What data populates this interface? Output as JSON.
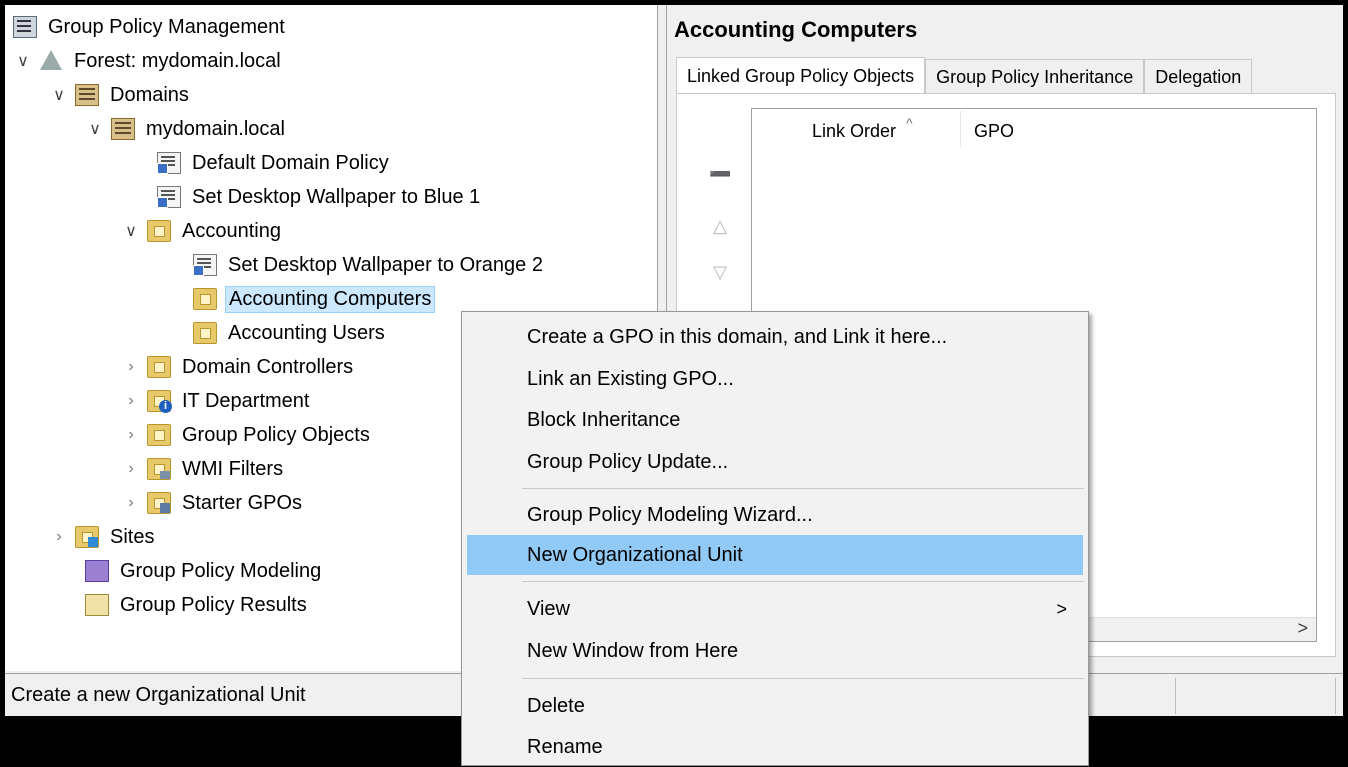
{
  "tree": {
    "root": "Group Policy Management",
    "forest": "Forest: mydomain.local",
    "domains": "Domains",
    "domain": "mydomain.local",
    "default_domain_policy": "Default Domain Policy",
    "wallpaper_blue": "Set Desktop Wallpaper to Blue 1",
    "accounting": "Accounting",
    "wallpaper_orange": "Set Desktop Wallpaper to Orange 2",
    "accounting_computers": "Accounting Computers",
    "accounting_users": "Accounting Users",
    "domain_controllers": "Domain Controllers",
    "it_department": "IT Department",
    "group_policy_objects": "Group Policy Objects",
    "wmi_filters": "WMI Filters",
    "starter_gpos": "Starter GPOs",
    "sites": "Sites",
    "gp_modeling": "Group Policy Modeling",
    "gp_results": "Group Policy Results",
    "expanded_arrow": "∨",
    "collapsed_arrow": "›"
  },
  "right_pane": {
    "title": "Accounting Computers",
    "tabs": [
      {
        "label": "Linked Group Policy Objects",
        "active": true
      },
      {
        "label": "Group Policy Inheritance",
        "active": false
      },
      {
        "label": "Delegation",
        "active": false
      }
    ],
    "columns": [
      "Link Order",
      "GPO"
    ],
    "sort_caret": "^",
    "move_buttons": [
      "➖",
      "△",
      "▽"
    ],
    "scroll_right": ">"
  },
  "status_bar": {
    "text": "Create a new Organizational Unit"
  },
  "context_menu": {
    "items": [
      {
        "label": "Create a GPO in this domain, and Link it here..."
      },
      {
        "label": "Link an Existing GPO..."
      },
      {
        "label": "Block Inheritance"
      },
      {
        "label": "Group Policy Update..."
      },
      {
        "label": "Group Policy Modeling Wizard..."
      },
      {
        "label": "New Organizational Unit",
        "highlighted": true
      },
      {
        "label": "View",
        "submenu_arrow": ">"
      },
      {
        "label": "New Window from Here"
      },
      {
        "label": "Delete"
      },
      {
        "label": "Rename"
      }
    ]
  },
  "colors": {
    "selection": "#cce8ff",
    "menu_highlight": "#91c9f7",
    "window_bg": "#f0f0f0"
  }
}
